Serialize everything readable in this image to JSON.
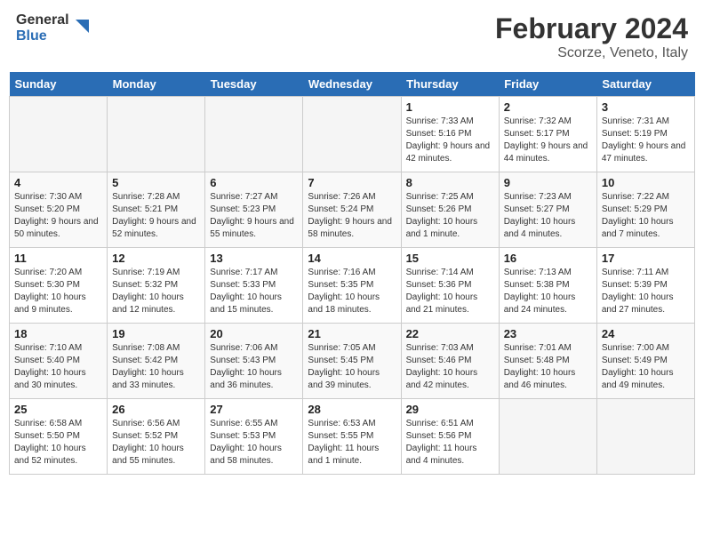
{
  "header": {
    "logo_line1": "General",
    "logo_line2": "Blue",
    "month_title": "February 2024",
    "location": "Scorze, Veneto, Italy"
  },
  "days_of_week": [
    "Sunday",
    "Monday",
    "Tuesday",
    "Wednesday",
    "Thursday",
    "Friday",
    "Saturday"
  ],
  "weeks": [
    {
      "days": [
        {
          "num": "",
          "empty": true
        },
        {
          "num": "",
          "empty": true
        },
        {
          "num": "",
          "empty": true
        },
        {
          "num": "",
          "empty": true
        },
        {
          "num": "1",
          "rise": "7:33 AM",
          "set": "5:16 PM",
          "daylight": "9 hours and 42 minutes."
        },
        {
          "num": "2",
          "rise": "7:32 AM",
          "set": "5:17 PM",
          "daylight": "9 hours and 44 minutes."
        },
        {
          "num": "3",
          "rise": "7:31 AM",
          "set": "5:19 PM",
          "daylight": "9 hours and 47 minutes."
        }
      ]
    },
    {
      "days": [
        {
          "num": "4",
          "rise": "7:30 AM",
          "set": "5:20 PM",
          "daylight": "9 hours and 50 minutes."
        },
        {
          "num": "5",
          "rise": "7:28 AM",
          "set": "5:21 PM",
          "daylight": "9 hours and 52 minutes."
        },
        {
          "num": "6",
          "rise": "7:27 AM",
          "set": "5:23 PM",
          "daylight": "9 hours and 55 minutes."
        },
        {
          "num": "7",
          "rise": "7:26 AM",
          "set": "5:24 PM",
          "daylight": "9 hours and 58 minutes."
        },
        {
          "num": "8",
          "rise": "7:25 AM",
          "set": "5:26 PM",
          "daylight": "10 hours and 1 minute."
        },
        {
          "num": "9",
          "rise": "7:23 AM",
          "set": "5:27 PM",
          "daylight": "10 hours and 4 minutes."
        },
        {
          "num": "10",
          "rise": "7:22 AM",
          "set": "5:29 PM",
          "daylight": "10 hours and 7 minutes."
        }
      ]
    },
    {
      "days": [
        {
          "num": "11",
          "rise": "7:20 AM",
          "set": "5:30 PM",
          "daylight": "10 hours and 9 minutes."
        },
        {
          "num": "12",
          "rise": "7:19 AM",
          "set": "5:32 PM",
          "daylight": "10 hours and 12 minutes."
        },
        {
          "num": "13",
          "rise": "7:17 AM",
          "set": "5:33 PM",
          "daylight": "10 hours and 15 minutes."
        },
        {
          "num": "14",
          "rise": "7:16 AM",
          "set": "5:35 PM",
          "daylight": "10 hours and 18 minutes."
        },
        {
          "num": "15",
          "rise": "7:14 AM",
          "set": "5:36 PM",
          "daylight": "10 hours and 21 minutes."
        },
        {
          "num": "16",
          "rise": "7:13 AM",
          "set": "5:38 PM",
          "daylight": "10 hours and 24 minutes."
        },
        {
          "num": "17",
          "rise": "7:11 AM",
          "set": "5:39 PM",
          "daylight": "10 hours and 27 minutes."
        }
      ]
    },
    {
      "days": [
        {
          "num": "18",
          "rise": "7:10 AM",
          "set": "5:40 PM",
          "daylight": "10 hours and 30 minutes."
        },
        {
          "num": "19",
          "rise": "7:08 AM",
          "set": "5:42 PM",
          "daylight": "10 hours and 33 minutes."
        },
        {
          "num": "20",
          "rise": "7:06 AM",
          "set": "5:43 PM",
          "daylight": "10 hours and 36 minutes."
        },
        {
          "num": "21",
          "rise": "7:05 AM",
          "set": "5:45 PM",
          "daylight": "10 hours and 39 minutes."
        },
        {
          "num": "22",
          "rise": "7:03 AM",
          "set": "5:46 PM",
          "daylight": "10 hours and 42 minutes."
        },
        {
          "num": "23",
          "rise": "7:01 AM",
          "set": "5:48 PM",
          "daylight": "10 hours and 46 minutes."
        },
        {
          "num": "24",
          "rise": "7:00 AM",
          "set": "5:49 PM",
          "daylight": "10 hours and 49 minutes."
        }
      ]
    },
    {
      "days": [
        {
          "num": "25",
          "rise": "6:58 AM",
          "set": "5:50 PM",
          "daylight": "10 hours and 52 minutes."
        },
        {
          "num": "26",
          "rise": "6:56 AM",
          "set": "5:52 PM",
          "daylight": "10 hours and 55 minutes."
        },
        {
          "num": "27",
          "rise": "6:55 AM",
          "set": "5:53 PM",
          "daylight": "10 hours and 58 minutes."
        },
        {
          "num": "28",
          "rise": "6:53 AM",
          "set": "5:55 PM",
          "daylight": "11 hours and 1 minute."
        },
        {
          "num": "29",
          "rise": "6:51 AM",
          "set": "5:56 PM",
          "daylight": "11 hours and 4 minutes."
        },
        {
          "num": "",
          "empty": true
        },
        {
          "num": "",
          "empty": true
        }
      ]
    }
  ]
}
